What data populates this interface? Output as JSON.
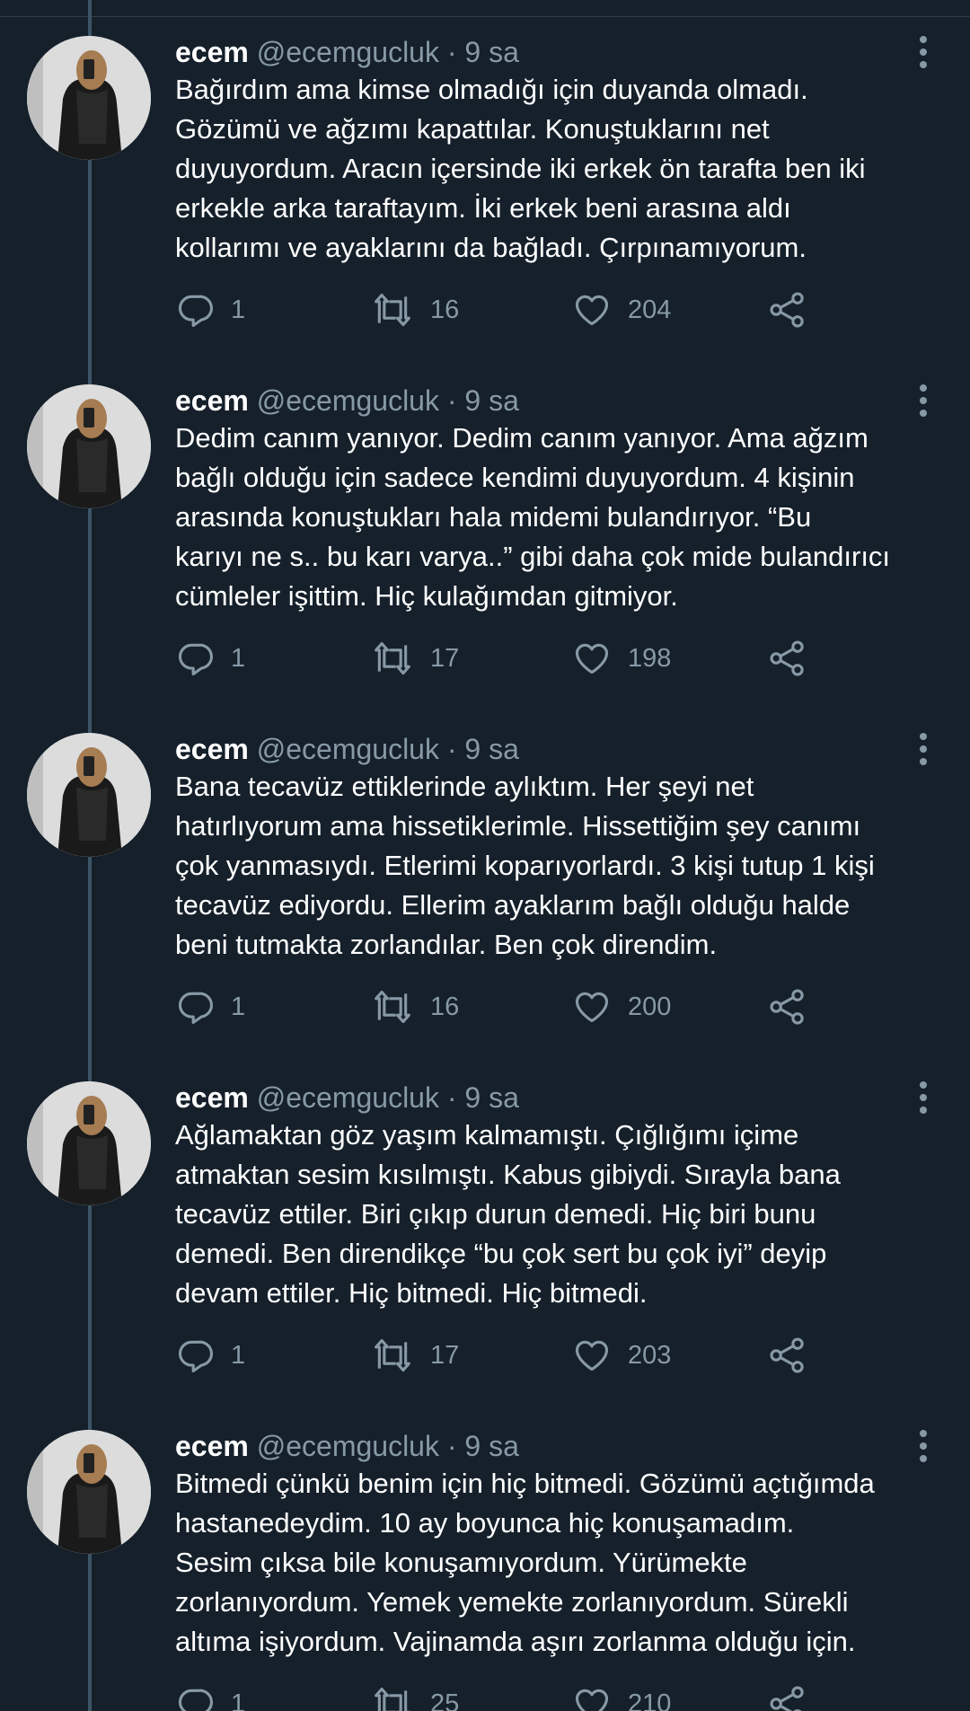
{
  "tweets": [
    {
      "name": "ecem",
      "handle": "@ecemgucluk",
      "separator": "·",
      "time": "9 sa",
      "text": "Bağırdım ama kimse olmadığı için duyanda olmadı.\nGözümü ve ağzımı kapattılar. Konuştuklarını net\nduyuyordum. Aracın içersinde iki erkek ön tarafta ben iki\nerkekle arka taraftayım. İki erkek beni arasına aldı\nkollarımı ve ayaklarını da bağladı. Çırpınamıyorum.",
      "replies": "1",
      "retweets": "16",
      "likes": "204"
    },
    {
      "name": "ecem",
      "handle": "@ecemgucluk",
      "separator": "·",
      "time": "9 sa",
      "text": "Dedim canım yanıyor. Dedim canım yanıyor. Ama ağzım\nbağlı olduğu için sadece kendimi duyuyordum. 4 kişinin\narasında konuştukları hala midemi bulandırıyor. “Bu\nkarıyı ne s.. bu karı varya..” gibi daha çok mide bulandırıcı\ncümleler işittim. Hiç kulağımdan gitmiyor.",
      "replies": "1",
      "retweets": "17",
      "likes": "198"
    },
    {
      "name": "ecem",
      "handle": "@ecemgucluk",
      "separator": "·",
      "time": "9 sa",
      "text": "Bana tecavüz ettiklerinde aylıktım. Her şeyi net\nhatırlıyorum ama hissetiklerimle. Hissettiğim şey canımı\nçok yanmasıydı. Etlerimi koparıyorlardı. 3 kişi tutup 1 kişi\ntecavüz ediyordu. Ellerim ayaklarım bağlı olduğu halde\nbeni tutmakta zorlandılar. Ben çok direndim.",
      "replies": "1",
      "retweets": "16",
      "likes": "200"
    },
    {
      "name": "ecem",
      "handle": "@ecemgucluk",
      "separator": "·",
      "time": "9 sa",
      "text": "Ağlamaktan göz yaşım kalmamıştı. Çığlığımı içime\natmaktan sesim kısılmıştı. Kabus gibiydi. Sırayla bana\ntecavüz ettiler. Biri çıkıp durun demedi. Hiç biri bunu\ndemedi. Ben direndikçe “bu çok sert bu çok iyi” deyip\ndevam ettiler. Hiç bitmedi. Hiç bitmedi.",
      "replies": "1",
      "retweets": "17",
      "likes": "203"
    },
    {
      "name": "ecem",
      "handle": "@ecemgucluk",
      "separator": "·",
      "time": "9 sa",
      "text": "Bitmedi çünkü benim için hiç bitmedi. Gözümü açtığımda\nhastanedeydim. 10 ay boyunca hiç konuşamadım.\nSesim çıksa bile konuşamıyordum. Yürümekte\nzorlanıyordum. Yemek yemekte zorlanıyordum. Sürekli\naltıma işiyordum. Vajinamda aşırı zorlanma olduğu için.",
      "replies": "1",
      "retweets": "25",
      "likes": "210"
    }
  ],
  "icons": {
    "reply": "reply-icon",
    "retweet": "retweet-icon",
    "like": "heart-icon",
    "share": "share-icon",
    "more": "more-options-icon"
  },
  "colors": {
    "background": "#15202b",
    "secondary_text": "#8899a6",
    "thread_line": "#3d5466"
  }
}
